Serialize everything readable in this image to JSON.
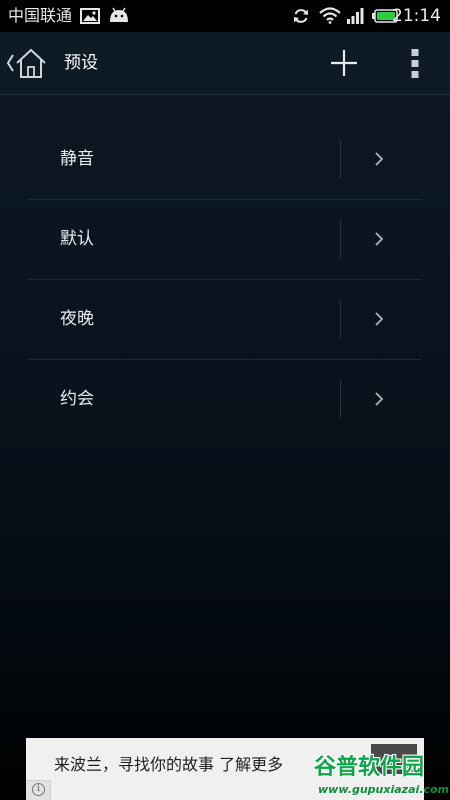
{
  "status_bar": {
    "carrier": "中国联通",
    "time": "21:14",
    "icons": [
      "gallery-icon",
      "android-icon",
      "sync-icon",
      "wifi-icon",
      "signal-icon",
      "battery-icon"
    ],
    "battery_color": "#2ecc40"
  },
  "action_bar": {
    "title": "预设",
    "icons": [
      "back-chevron-icon",
      "home-icon",
      "plus-icon",
      "overflow-menu-icon"
    ]
  },
  "presets": [
    {
      "label": "静音"
    },
    {
      "label": "默认"
    },
    {
      "label": "夜晚"
    },
    {
      "label": "约会"
    }
  ],
  "ad": {
    "text": "来波兰，寻找你的故事 了解更多",
    "info_icon": "info-icon"
  },
  "watermark": {
    "brand": "谷普软件园",
    "url": "www.gupuxiazai.com"
  },
  "colors": {
    "background_top": "#0d1822",
    "background_bottom": "#000000",
    "text": "#e8ecef",
    "watermark_green": "#0fa64a"
  }
}
